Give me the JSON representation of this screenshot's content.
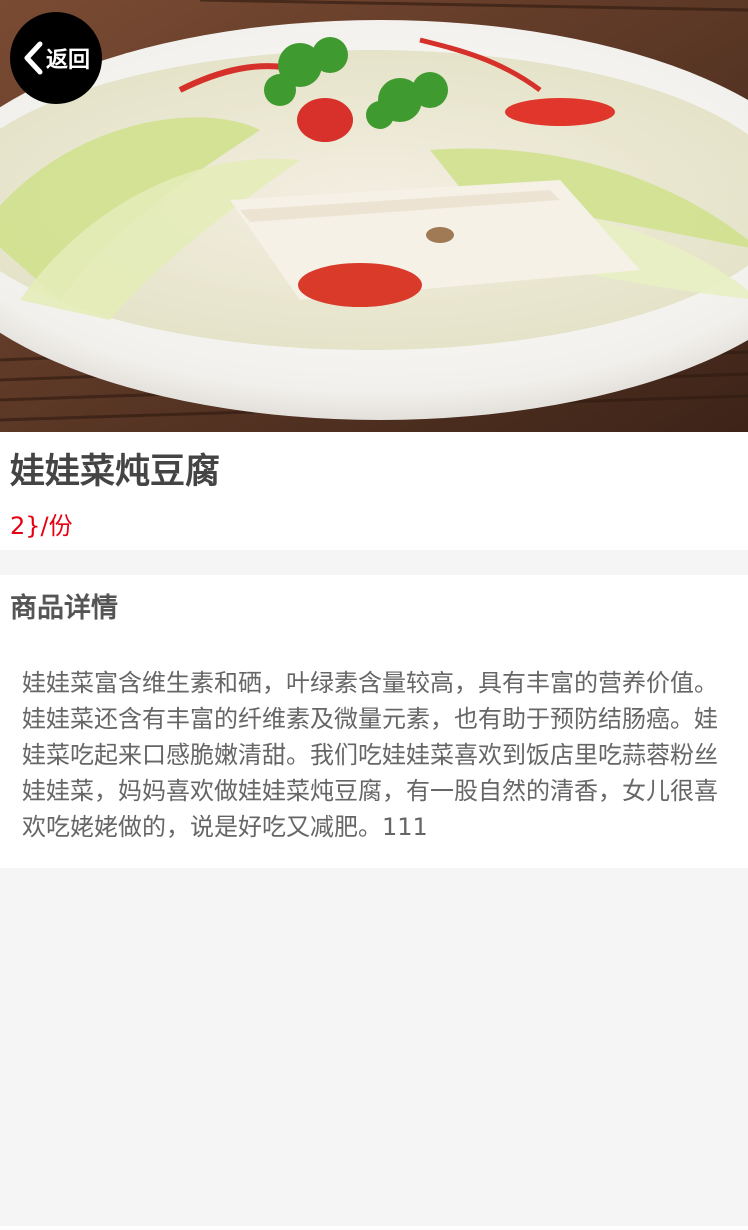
{
  "header": {
    "back_label": "返回"
  },
  "product": {
    "title": "娃娃菜炖豆腐",
    "price": "2}/份"
  },
  "detail": {
    "heading": "商品详情",
    "description": "娃娃菜富含维生素和硒，叶绿素含量较高，具有丰富的营养价值。娃娃菜还含有丰富的纤维素及微量元素，也有助于预防结肠癌。娃娃菜吃起来口感脆嫩清甜。我们吃娃娃菜喜欢到饭店里吃蒜蓉粉丝娃娃菜，妈妈喜欢做娃娃菜炖豆腐，有一股自然的清香，女儿很喜欢吃姥姥做的，说是好吃又减肥。111"
  },
  "colors": {
    "price": "#e60012",
    "title": "#444444",
    "background": "#f5f5f5"
  }
}
